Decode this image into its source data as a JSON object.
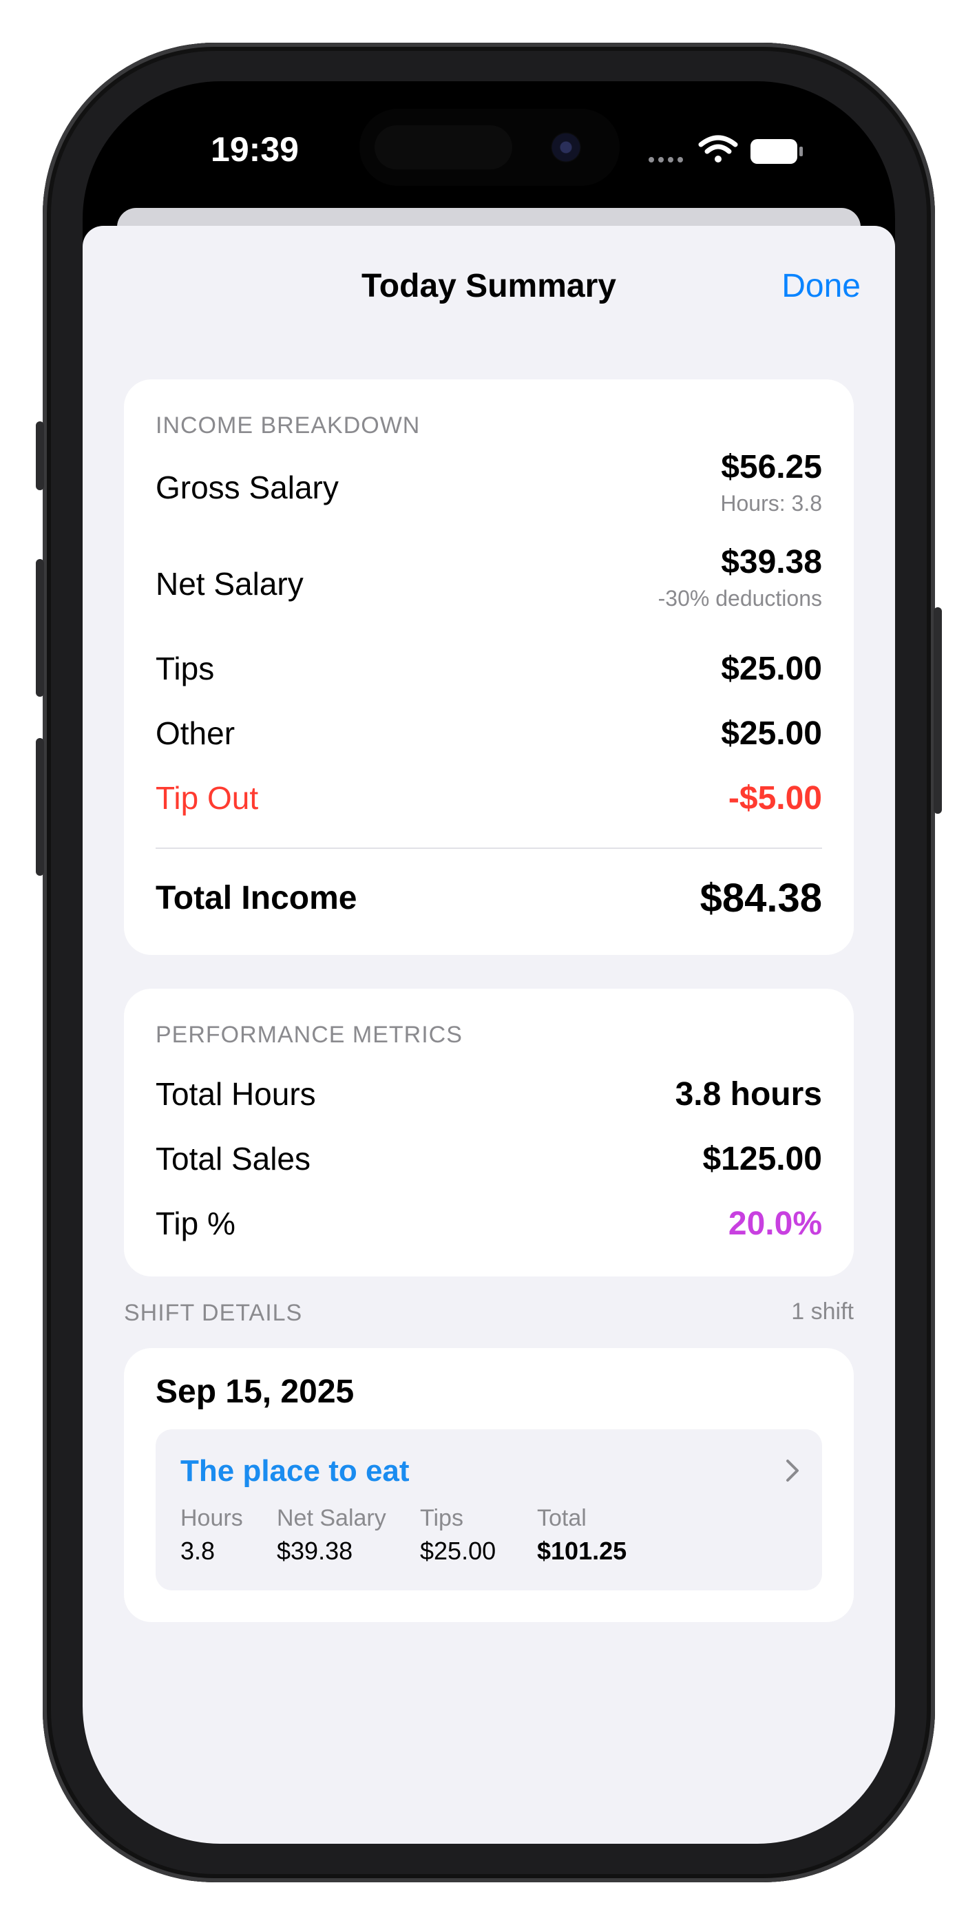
{
  "status_bar": {
    "time": "19:39"
  },
  "nav": {
    "title": "Today Summary",
    "done_label": "Done"
  },
  "income": {
    "section_label": "INCOME BREAKDOWN",
    "gross_label": "Gross Salary",
    "gross_value": "$56.25",
    "gross_sub": "Hours: 3.8",
    "net_label": "Net Salary",
    "net_value": "$39.38",
    "net_sub": "-30% deductions",
    "tips_label": "Tips",
    "tips_value": "$25.00",
    "other_label": "Other",
    "other_value": "$25.00",
    "tipout_label": "Tip Out",
    "tipout_value": "-$5.00",
    "total_label": "Total Income",
    "total_value": "$84.38"
  },
  "performance": {
    "section_label": "PERFORMANCE METRICS",
    "hours_label": "Total Hours",
    "hours_value": "3.8 hours",
    "sales_label": "Total Sales",
    "sales_value": "$125.00",
    "tip_pct_label": "Tip %",
    "tip_pct_value": "20.0%"
  },
  "shift_details": {
    "section_label": "SHIFT DETAILS",
    "count_label": "1 shift",
    "date": "Sep 15, 2025",
    "shift": {
      "place": "The place to eat",
      "hours_label": "Hours",
      "hours_value": "3.8",
      "net_label": "Net Salary",
      "net_value": "$39.38",
      "tips_label": "Tips",
      "tips_value": "$25.00",
      "total_label": "Total",
      "total_value": "$101.25"
    }
  },
  "colors": {
    "accent": "#0a84ff",
    "place_link": "#1a8cf0",
    "negative": "#ff3b30",
    "tip_percent": "#c840e0"
  }
}
